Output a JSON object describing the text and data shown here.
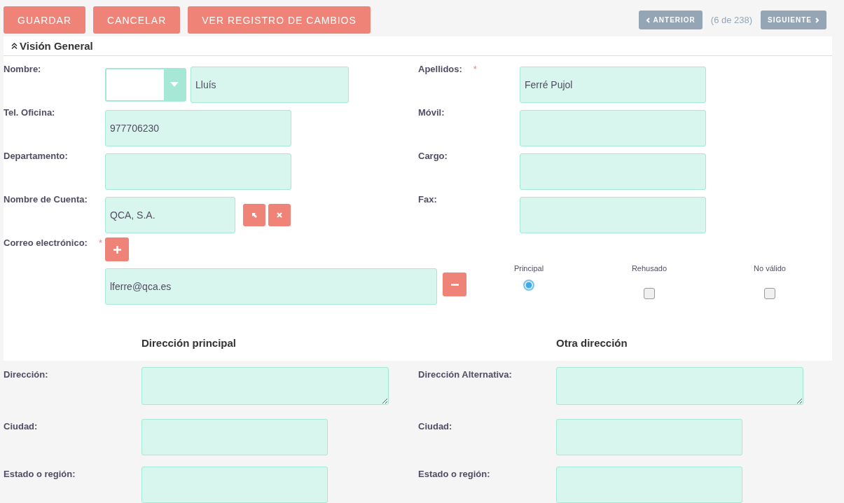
{
  "toolbar": {
    "actions": [
      {
        "label": "GUARDAR"
      },
      {
        "label": "CANCELAR"
      },
      {
        "label": "VER REGISTRO DE CAMBIOS"
      }
    ],
    "pager": {
      "previous": "ANTERIOR",
      "counter": "(6 de 238)",
      "next": "SIGUIENTE"
    }
  },
  "required_mark": "*",
  "panel": {
    "title": "Visión General",
    "expanded": true,
    "rows": [
      {
        "left": {
          "label": "Nombre:",
          "required": false,
          "kind": "name",
          "value": "Lluís"
        },
        "right": {
          "label": "Apellidos:",
          "required": true,
          "kind": "text",
          "value": "Ferré Pujol"
        }
      },
      {
        "left": {
          "label": "Tel. Oficina:",
          "required": false,
          "kind": "text",
          "value": "977706230"
        },
        "right": {
          "label": "Móvil:",
          "required": false,
          "kind": "text"
        }
      },
      {
        "left": {
          "label": "Departamento:",
          "required": false,
          "kind": "text"
        },
        "right": {
          "label": "Cargo:",
          "required": false,
          "kind": "text"
        }
      },
      {
        "left": {
          "label": "Nombre de Cuenta:",
          "required": false,
          "kind": "relate",
          "value": "QCA, S.A."
        },
        "right": {
          "label": "Fax:",
          "required": false,
          "kind": "text"
        }
      }
    ],
    "email": {
      "label": "Correo electrónico:",
      "required": true,
      "flag_headers": [
        "Principal",
        "Rehusado",
        "No válido"
      ],
      "addresses": [
        {
          "value": "lferre@qca.es",
          "primary": true,
          "opted_out": false,
          "invalid": false
        }
      ]
    }
  },
  "address": {
    "columns": [
      {
        "title": "Dirección principal",
        "fields": [
          {
            "label": "Dirección:",
            "kind": "textarea"
          },
          {
            "label": "Ciudad:",
            "kind": "text"
          },
          {
            "label": "Estado o región:",
            "kind": "text"
          }
        ]
      },
      {
        "title": "Otra dirección",
        "fields": [
          {
            "label": "Dirección Alternativa:",
            "kind": "textarea"
          },
          {
            "label": "Ciudad:",
            "kind": "text"
          },
          {
            "label": "Estado o región:",
            "kind": "text"
          }
        ]
      }
    ]
  }
}
